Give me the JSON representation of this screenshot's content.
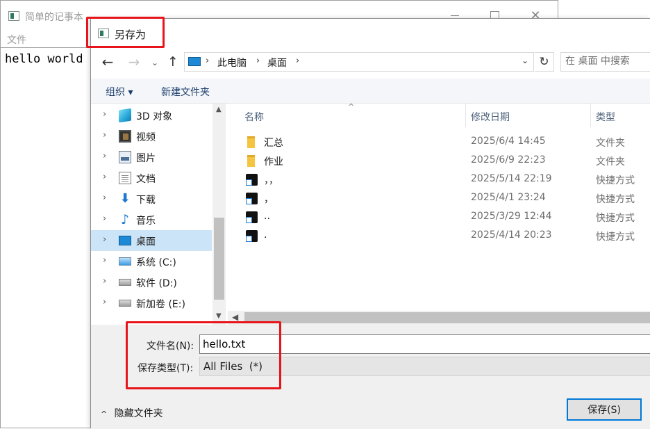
{
  "notepad": {
    "title": "简单的记事本",
    "menu_file": "文件",
    "content": "hello world",
    "close_glyph": "✕"
  },
  "dialog": {
    "title": "另存为",
    "nav": {
      "back_glyph": "←",
      "forward_glyph": "→",
      "recent_glyph": "⌄",
      "up_glyph": "↑",
      "refresh_glyph": "↻"
    },
    "address": {
      "crumbs": [
        "此电脑",
        "桌面"
      ],
      "separator": "›",
      "dropdown_glyph": "⌄"
    },
    "search": {
      "placeholder": "在 桌面 中搜索"
    },
    "toolbar": {
      "organize": "组织 ▾",
      "new_folder": "新建文件夹"
    },
    "nav_pane": {
      "items": [
        {
          "label": "3D 对象",
          "icon": "3d-objects-icon"
        },
        {
          "label": "视频",
          "icon": "video-icon"
        },
        {
          "label": "图片",
          "icon": "pictures-icon"
        },
        {
          "label": "文档",
          "icon": "documents-icon"
        },
        {
          "label": "下载",
          "icon": "downloads-icon"
        },
        {
          "label": "音乐",
          "icon": "music-icon"
        },
        {
          "label": "桌面",
          "icon": "desktop-icon",
          "selected": true
        },
        {
          "label": "系统 (C:)",
          "icon": "system-drive-icon"
        },
        {
          "label": "软件 (D:)",
          "icon": "drive-icon"
        },
        {
          "label": "新加卷 (E:)",
          "icon": "drive-icon"
        }
      ],
      "chevron": "›"
    },
    "file_list": {
      "columns": {
        "name": "名称",
        "date": "修改日期",
        "type": "类型"
      },
      "sort_glyph": "^",
      "rows": [
        {
          "name": "汇总",
          "date": "2025/6/4 14:45",
          "type": "文件夹",
          "icon": "folder-icon"
        },
        {
          "name": "作业",
          "date": "2025/6/9 22:23",
          "type": "文件夹",
          "icon": "folder-icon"
        },
        {
          "name": "，，",
          "date": "2025/5/14 22:19",
          "type": "快捷方式",
          "icon": "shortcut-icon"
        },
        {
          "name": "，",
          "date": "2025/4/1 23:24",
          "type": "快捷方式",
          "icon": "shortcut-icon"
        },
        {
          "name": "..",
          "date": "2025/3/29 12:44",
          "type": "快捷方式",
          "icon": "shortcut-icon"
        },
        {
          "name": ".",
          "date": "2025/4/14 20:23",
          "type": "快捷方式",
          "icon": "shortcut-icon"
        }
      ]
    },
    "fields": {
      "filename_label": "文件名(N):",
      "filename_value": "hello.txt",
      "filetype_label": "保存类型(T):",
      "filetype_value": "All Files  (*)"
    },
    "footer": {
      "hide_folders": "隐藏文件夹",
      "hide_caret": "^",
      "save": "保存(S)"
    }
  },
  "colors": {
    "accent": "#0078d7",
    "selection": "#cce4f7",
    "annotation": "#e8141b"
  }
}
